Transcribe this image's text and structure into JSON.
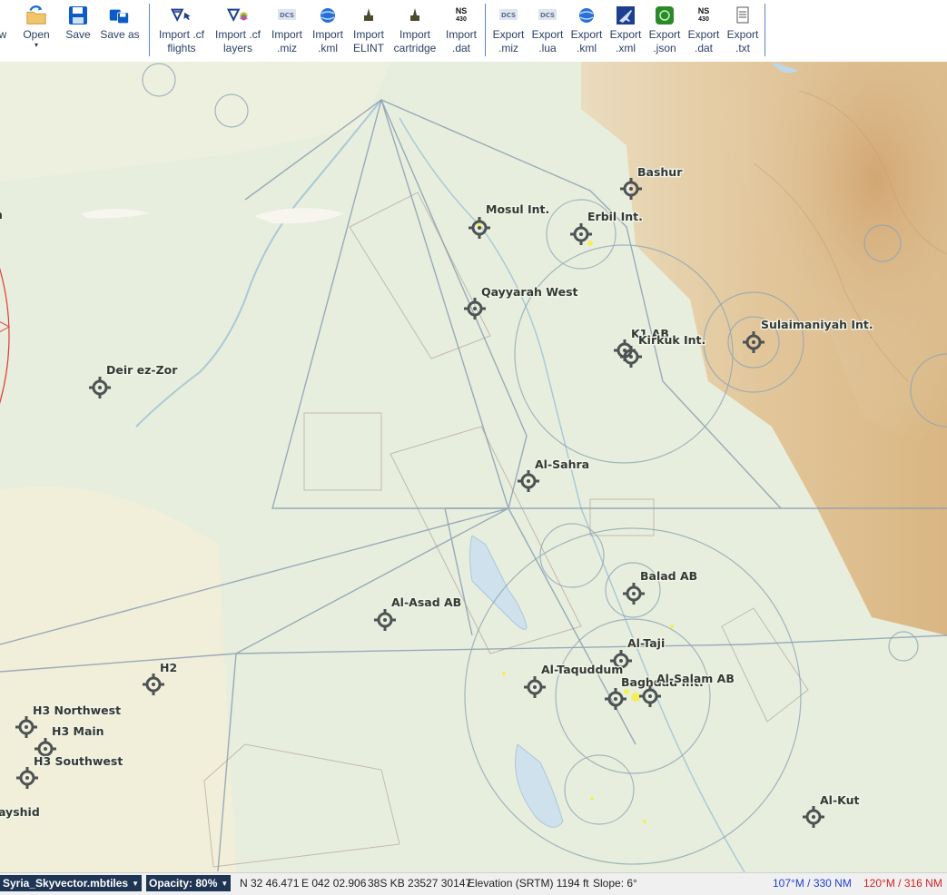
{
  "toolbar": {
    "new_label": "w",
    "open_label": "Open",
    "save_label": "Save",
    "saveas_label": "Save as",
    "import_cf_flights": [
      "Import .cf",
      "flights"
    ],
    "import_cf_layers": [
      "Import .cf",
      "layers"
    ],
    "import_miz": [
      "Import",
      ".miz"
    ],
    "import_kml": [
      "Import",
      ".kml"
    ],
    "import_elint": [
      "Import",
      "ELINT"
    ],
    "import_cartridge": [
      "Import",
      "cartridge"
    ],
    "import_dat": [
      "Import",
      ".dat"
    ],
    "export_miz": [
      "Export",
      ".miz"
    ],
    "export_lua": [
      "Export",
      ".lua"
    ],
    "export_kml": [
      "Export",
      ".kml"
    ],
    "export_xml": [
      "Export",
      ".xml"
    ],
    "export_json": [
      "Export",
      ".json"
    ],
    "export_dat": [
      "Export",
      ".dat"
    ],
    "export_txt": [
      "Export",
      ".txt"
    ],
    "ns430_icon_text": [
      "NS",
      "430"
    ],
    "dcs_icon_text": "DCS"
  },
  "map": {
    "airbases": [
      {
        "name": "Bashur"
      },
      {
        "name": "Mosul Int."
      },
      {
        "name": "Erbil Int."
      },
      {
        "name": "Qayyarah West"
      },
      {
        "name": "K1 AB"
      },
      {
        "name": "Kirkuk Int."
      },
      {
        "name": "Sulaimaniyah Int."
      },
      {
        "name": "Deir ez-Zor"
      },
      {
        "name": "Al-Sahra"
      },
      {
        "name": "Balad AB"
      },
      {
        "name": "Al-Asad AB"
      },
      {
        "name": "Al-Taji"
      },
      {
        "name": "Al-Taquddum"
      },
      {
        "name": "Baghdad Int."
      },
      {
        "name": "Al-Salam AB"
      },
      {
        "name": "H2"
      },
      {
        "name": "H3 Northwest"
      },
      {
        "name": "H3 Main"
      },
      {
        "name": "H3 Southwest"
      },
      {
        "name": "Al-Kut"
      },
      {
        "name": "ayshid"
      },
      {
        "name": "n"
      }
    ]
  },
  "status": {
    "map_source": "Syria_Skyvector.mbtiles",
    "opacity": "Opacity: 80%",
    "lat": "N 32 46.471",
    "lon": "E 042 02.906",
    "mgrs": "38S KB 23527 30147",
    "elevation": "Elevation (SRTM) 1194 ft",
    "slope": "Slope: 6°",
    "blue_bearing": "107°M / 330 NM",
    "red_bearing": "120°M / 316 NM",
    "blue_color": "#1f3fd6",
    "red_color": "#d61f1f"
  }
}
